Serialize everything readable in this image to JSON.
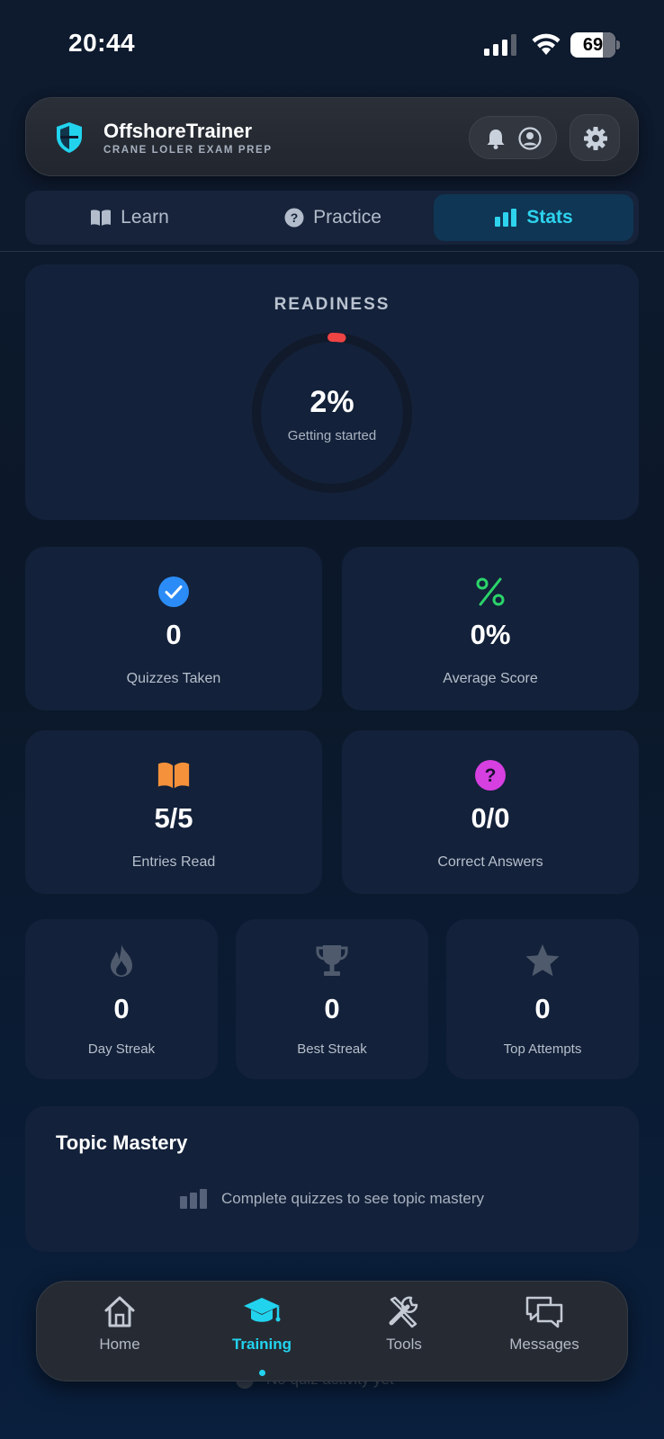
{
  "status_bar": {
    "time": "20:44",
    "battery": "69",
    "icons": [
      "signal-icon",
      "wifi-icon",
      "battery-icon"
    ]
  },
  "header": {
    "title": "OffshoreTrainer",
    "subtitle": "CRANE LOLER EXAM PREP",
    "icons": [
      "shield-logo-icon",
      "bell-icon",
      "user-icon",
      "gear-icon"
    ]
  },
  "tabs": [
    {
      "label": "Learn",
      "icon": "book-icon",
      "active": false
    },
    {
      "label": "Practice",
      "icon": "question-icon",
      "active": false
    },
    {
      "label": "Stats",
      "icon": "bar-chart-icon",
      "active": true
    }
  ],
  "readiness": {
    "title": "READINESS",
    "value": "2%",
    "progress_percent": 2,
    "status": "Getting started",
    "progress_color": "#ef4444"
  },
  "stats": {
    "quizzes_taken": {
      "value": "0",
      "label": "Quizzes Taken",
      "icon": "check-circle-icon",
      "color": "#2b8cf7"
    },
    "average_score": {
      "value": "0%",
      "label": "Average Score",
      "icon": "percent-icon",
      "color": "#2bd46a"
    },
    "entries_read": {
      "value": "5/5",
      "label": "Entries Read",
      "icon": "open-book-icon",
      "color": "#f5913a"
    },
    "correct_answers": {
      "value": "0/0",
      "label": "Correct Answers",
      "icon": "question-circle-icon",
      "color": "#d63fe0"
    },
    "day_streak": {
      "value": "0",
      "label": "Day Streak",
      "icon": "flame-icon"
    },
    "best_streak": {
      "value": "0",
      "label": "Best Streak",
      "icon": "trophy-icon"
    },
    "top_attempts": {
      "value": "0",
      "label": "Top Attempts",
      "icon": "star-icon"
    }
  },
  "topic_mastery": {
    "title": "Topic Mastery",
    "empty_message": "Complete quizzes to see topic mastery"
  },
  "hidden_activity_text": "No quiz activity yet",
  "bottom_nav": [
    {
      "label": "Home",
      "icon": "home-icon",
      "active": false
    },
    {
      "label": "Training",
      "icon": "graduation-cap-icon",
      "active": true
    },
    {
      "label": "Tools",
      "icon": "tools-icon",
      "active": false
    },
    {
      "label": "Messages",
      "icon": "messages-icon",
      "active": false
    }
  ],
  "colors": {
    "accent": "#22d3ee",
    "background": "#0e1a2e",
    "card": "#13213a"
  }
}
